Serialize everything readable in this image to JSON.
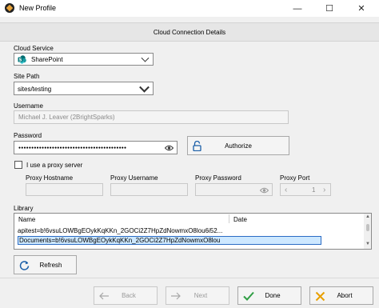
{
  "window": {
    "title": "New Profile",
    "minimize_glyph": "—",
    "maximize_glyph": "☐",
    "close_glyph": "✕"
  },
  "header": {
    "title": "Cloud Connection Details"
  },
  "cloud_service": {
    "label": "Cloud Service",
    "value": "SharePoint",
    "icon": "sharepoint-icon"
  },
  "site_path": {
    "label": "Site Path",
    "value": "sites/testing"
  },
  "username": {
    "label": "Username",
    "value": "Michael J. Leaver (2BrightSparks)"
  },
  "password": {
    "label": "Password",
    "value": "●●●●●●●●●●●●●●●●●●●●●●●●●●●●●●●●●●●●●●●●●●",
    "authorize_label": "Authorize"
  },
  "proxy": {
    "checkbox_label": "I use a proxy server",
    "checked": false,
    "hostname_label": "Proxy Hostname",
    "username_label": "Proxy Username",
    "password_label": "Proxy Password",
    "port_label": "Proxy Port",
    "port_value": "1"
  },
  "library": {
    "label": "Library",
    "columns": [
      "Name",
      "Date"
    ],
    "rows": [
      {
        "name": "apitest=b!6vsuLOWBgEOykKqKKn_2GOCi2Z7HpZdNowmxO8lou6i52...",
        "date": ""
      },
      {
        "name": "Documents=b!6vsuLOWBgEOykKqKKn_2GOCi2Z7HpZdNowmxO8lou",
        "date": ""
      }
    ],
    "refresh_label": "Refresh"
  },
  "footer": {
    "back_label": "Back",
    "next_label": "Next",
    "done_label": "Done",
    "abort_label": "Abort"
  },
  "colors": {
    "accent": "#2b6cc4",
    "done_check": "#2f9e44",
    "abort_x": "#e8a000",
    "refresh_arrow": "#1b5fa8",
    "sharepoint": "#038387"
  }
}
